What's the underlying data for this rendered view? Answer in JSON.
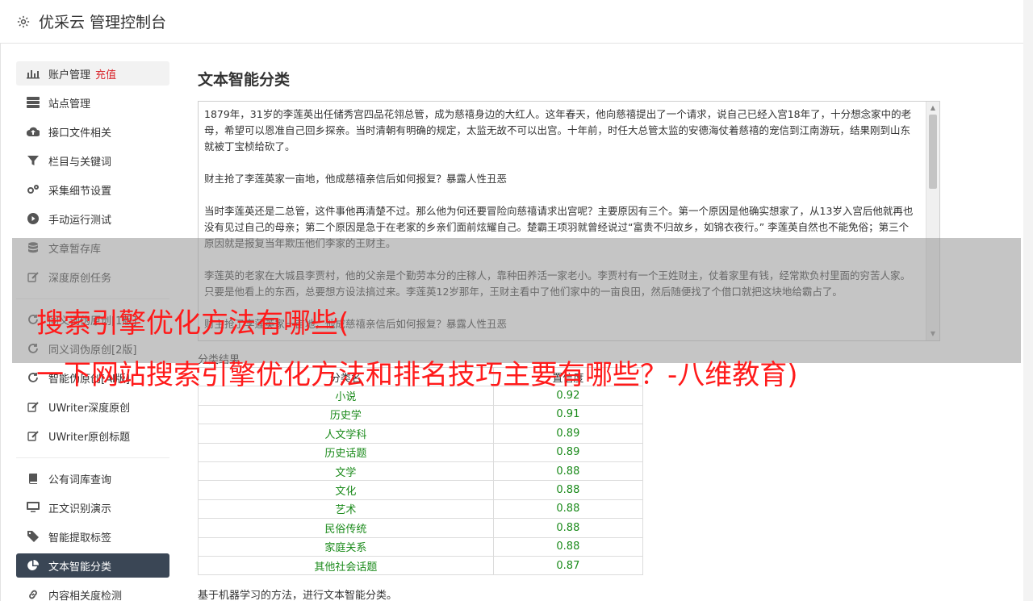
{
  "header": {
    "title": "优采云 管理控制台"
  },
  "sidebar": {
    "groups": [
      [
        {
          "label": "账户管理",
          "tag": "充值",
          "icon": "bar-chart-icon"
        },
        {
          "label": "站点管理",
          "icon": "server-icon"
        },
        {
          "label": "接口文件相关",
          "icon": "cloud-upload-icon"
        },
        {
          "label": "栏目与关键词",
          "icon": "filter-icon"
        },
        {
          "label": "采集细节设置",
          "icon": "gears-icon"
        },
        {
          "label": "手动运行测试",
          "icon": "play-circle-icon"
        },
        {
          "label": "文章暂存库",
          "icon": "database-icon"
        },
        {
          "label": "深度原创任务",
          "icon": "edit-icon"
        }
      ],
      [
        {
          "label": "同义词伪原创[1版]",
          "icon": "refresh-icon"
        },
        {
          "label": "同义词伪原创[2版]",
          "icon": "refresh-icon"
        },
        {
          "label": "智能伪原创[AI版]",
          "icon": "refresh-icon"
        },
        {
          "label": "UWriter深度原创",
          "icon": "edit-icon"
        },
        {
          "label": "UWriter原创标题",
          "icon": "edit-icon"
        }
      ],
      [
        {
          "label": "公有词库查询",
          "icon": "book-icon"
        },
        {
          "label": "正文识别演示",
          "icon": "monitor-icon"
        },
        {
          "label": "智能提取标签",
          "icon": "tag-icon"
        },
        {
          "label": "文本智能分类",
          "icon": "pie-chart-icon",
          "active": true
        },
        {
          "label": "内容相关度检测",
          "icon": "link-icon"
        }
      ]
    ]
  },
  "main": {
    "title": "文本智能分类",
    "paragraphs": [
      "1879年，31岁的李莲英出任储秀宫四品花翎总管，成为慈禧身边的大红人。这年春天，他向慈禧提出了一个请求，说自己已经入宫18年了，十分想念家中的老母，希望可以恩准自己回乡探亲。当时清朝有明确的规定，太监无故不可以出宫。十年前，时任大总管太监的安德海仗着慈禧的宠信到江南游玩，结果刚到山东就被丁宝桢给砍了。",
      "财主抢了李莲英家一亩地，他成慈禧亲信后如何报复？暴露人性丑恶",
      "当时李莲英还是二总管，这件事他再清楚不过。那么他为何还要冒险向慈禧请求出宫呢？主要原因有三个。第一个原因是他确实想家了，从13岁入宫后他就再也没有见过自己的母亲；第二个原因是急于在老家的乡亲们面前炫耀自己。楚霸王项羽就曾经说过“富贵不归故乡，如锦衣夜行。” 李莲英自然也不能免俗；第三个原因就是报复当年欺压他们李家的王财主。",
      "李莲英的老家在大城县李贾村，他的父亲是个勤劳本分的庄稼人，靠种田养活一家老小。李贾村有一个王姓财主，仗着家里有钱，经常欺负村里面的穷苦人家。只要是他看上的东西，总要想方设法搞过来。李莲英12岁那年，王财主看中了他们家中的一亩良田，然后随便找了个借口就把这块地给霸占了。",
      "财主抢了李莲英家一亩地，他成慈禧亲信后如何报复？暴露人性丑恶"
    ],
    "result_label": "分类结果",
    "table": {
      "headers": [
        "分类名",
        "置信度"
      ],
      "rows": [
        [
          "小说",
          "0.92"
        ],
        [
          "历史学",
          "0.91"
        ],
        [
          "人文学科",
          "0.89"
        ],
        [
          "历史话题",
          "0.89"
        ],
        [
          "文学",
          "0.88"
        ],
        [
          "文化",
          "0.88"
        ],
        [
          "艺术",
          "0.88"
        ],
        [
          "民俗传统",
          "0.88"
        ],
        [
          "家庭关系",
          "0.88"
        ],
        [
          "其他社会话题",
          "0.87"
        ]
      ]
    },
    "footnote": "基于机器学习的方法，进行文本智能分类。"
  },
  "watermark": {
    "line1": "搜索引擎优化方法有哪些(",
    "line2": "一下网站搜索引擎优化方法和排名技巧主要有哪些？-八维教育)"
  }
}
